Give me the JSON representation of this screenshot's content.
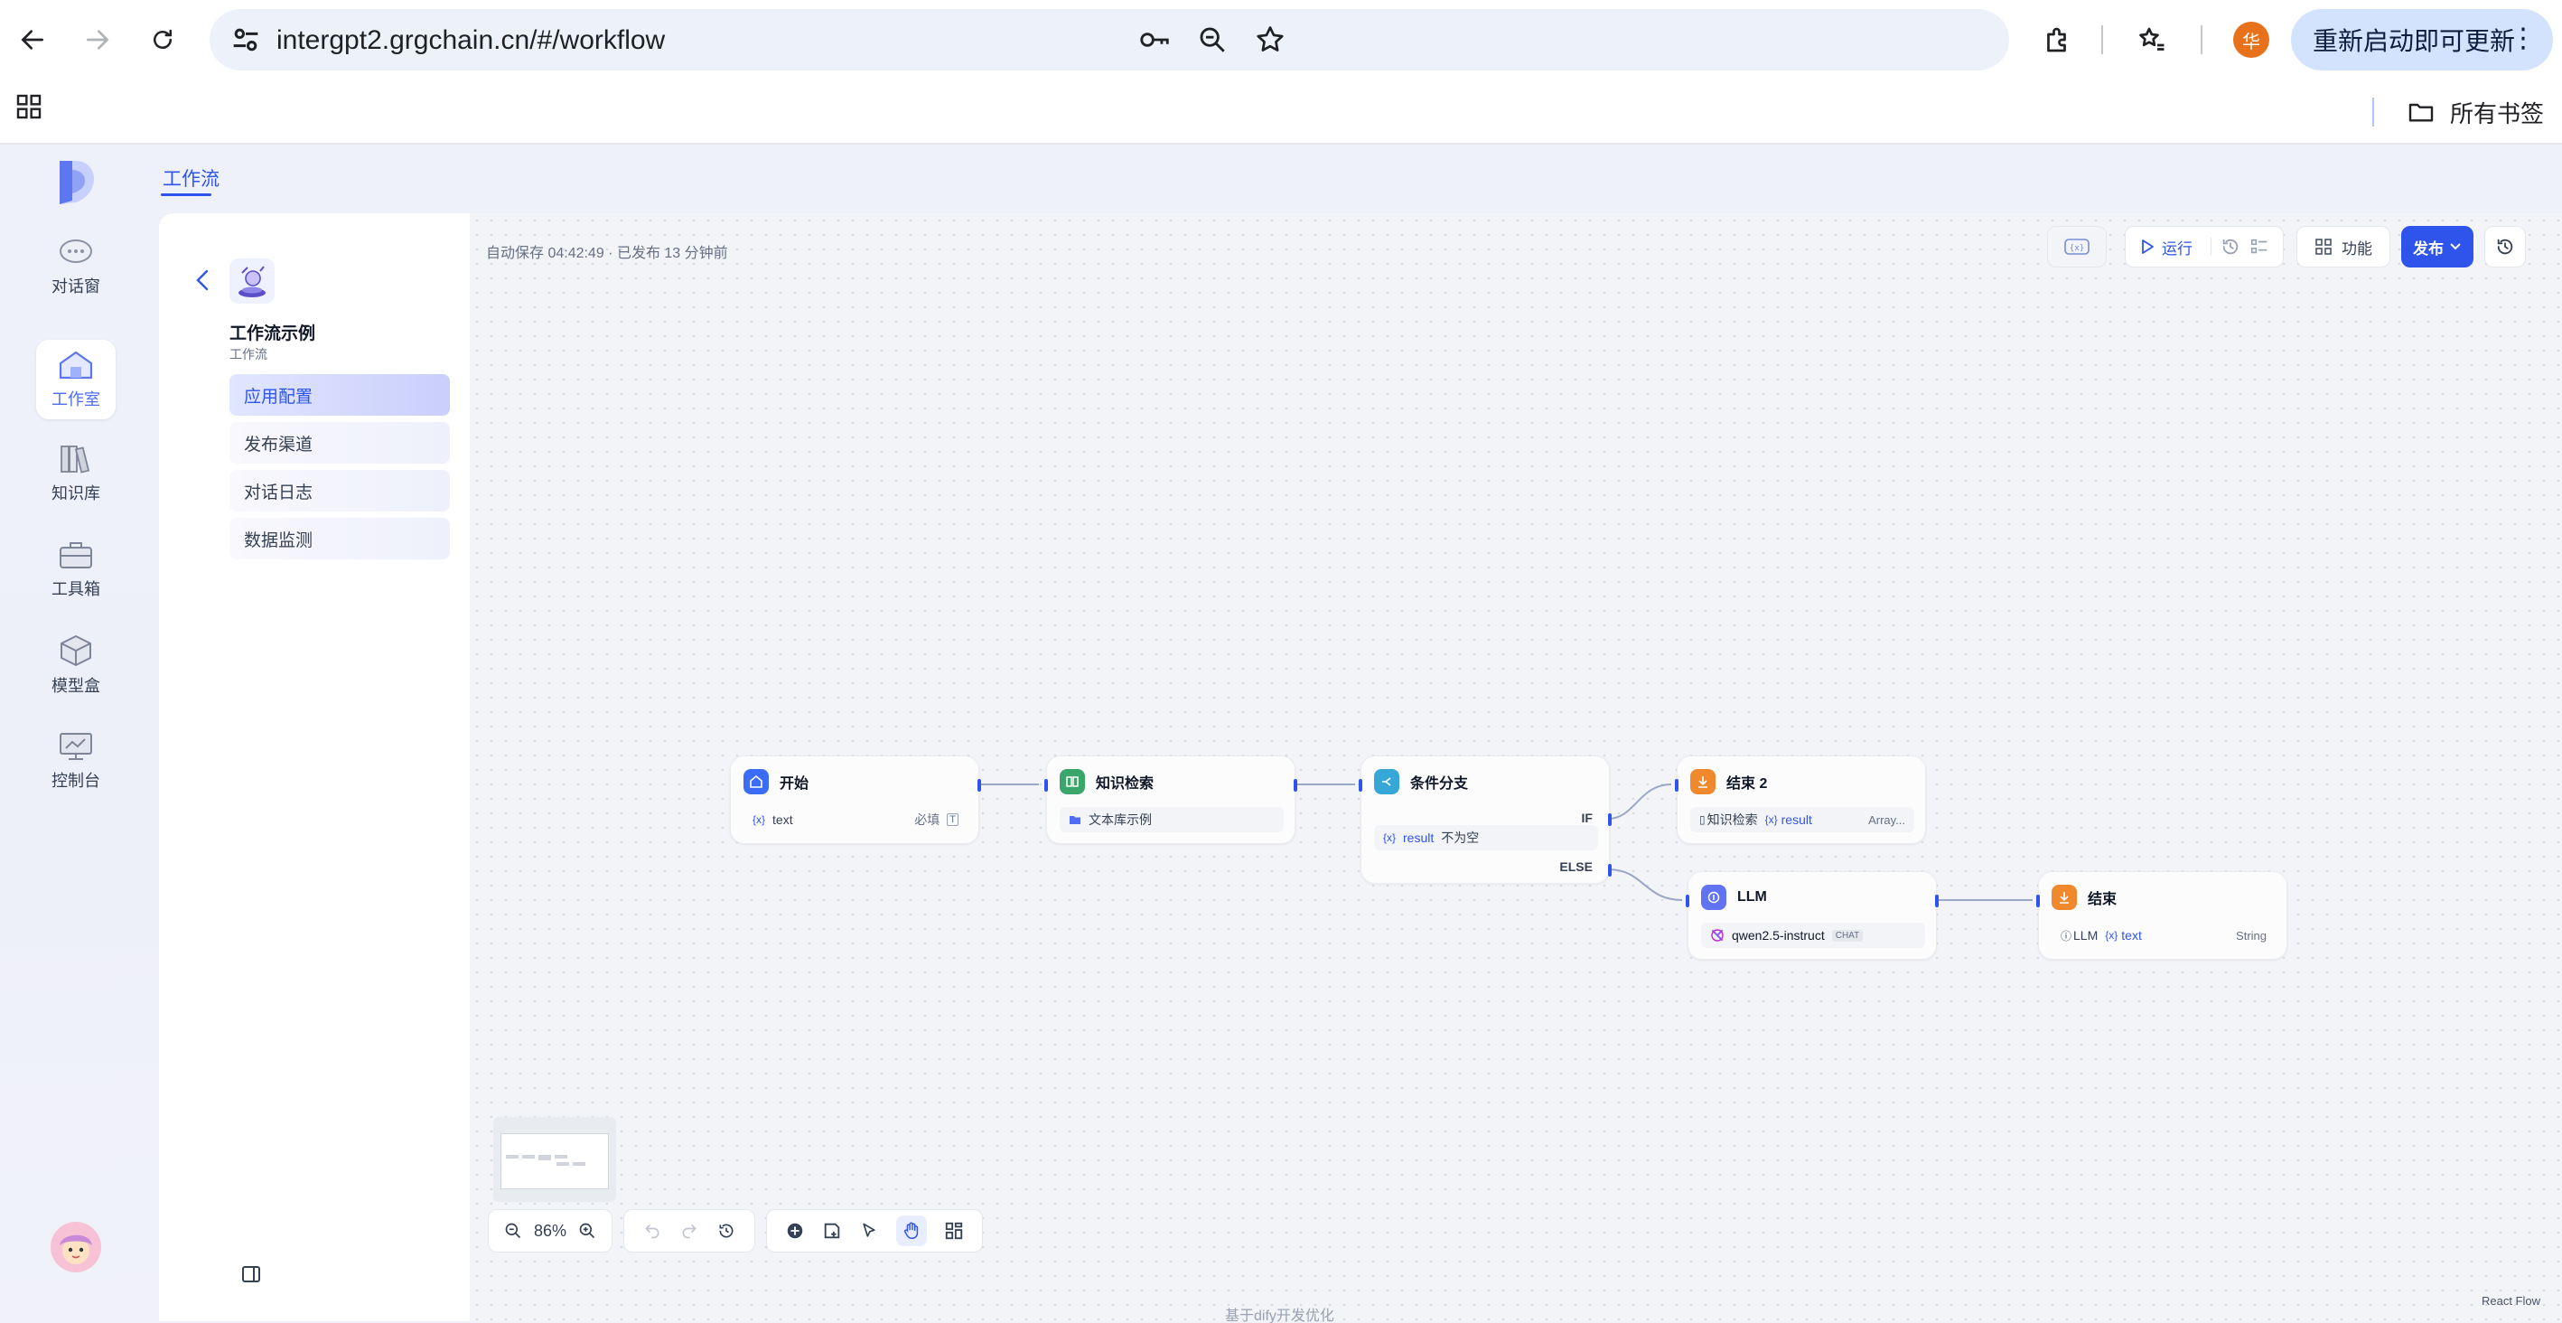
{
  "browser": {
    "url": "intergpt2.grgchain.cn/#/workflow",
    "update_button": "重新启动即可更新",
    "profile_initial": "华",
    "bookmarks_all": "所有书签"
  },
  "rail": {
    "items": [
      {
        "label": "对话窗",
        "icon": "chat-bubble-icon"
      },
      {
        "label": "工作室",
        "icon": "house-icon"
      },
      {
        "label": "知识库",
        "icon": "books-icon"
      },
      {
        "label": "工具箱",
        "icon": "toolbox-icon"
      },
      {
        "label": "模型盒",
        "icon": "box-icon"
      },
      {
        "label": "控制台",
        "icon": "monitor-icon"
      }
    ],
    "active": "工作室"
  },
  "top_tab": "工作流",
  "app": {
    "title": "工作流示例",
    "subtitle": "工作流",
    "menu": [
      "应用配置",
      "发布渠道",
      "对话日志",
      "数据监测"
    ],
    "active_menu": "应用配置"
  },
  "canvas": {
    "autosave": "自动保存 04:42:49 · 已发布 13 分钟前",
    "toolbar": {
      "run": "运行",
      "features": "功能",
      "publish": "发布",
      "env_var": "{x}"
    },
    "zoom": "86%"
  },
  "nodes": {
    "start": {
      "title": "开始",
      "var": "text",
      "required": "必填"
    },
    "knowledge": {
      "title": "知识检索",
      "dataset": "文本库示例"
    },
    "branch": {
      "title": "条件分支",
      "if_label": "IF",
      "else_label": "ELSE",
      "cond_var": "result",
      "cond_op": "不为空"
    },
    "end2": {
      "title": "结束 2",
      "source": "知识检索",
      "var": "result",
      "type": "Array..."
    },
    "llm": {
      "title": "LLM",
      "model": "qwen2.5-instruct",
      "mode": "CHAT"
    },
    "end": {
      "title": "结束",
      "source": "LLM",
      "var": "text",
      "type": "String"
    }
  },
  "footer": {
    "react_flow": "React Flow",
    "note": "基于dify开发优化"
  },
  "colors": {
    "accent": "#2f54eb",
    "start": "#3b6cf5",
    "knowledge": "#3aa66a",
    "branch": "#36a7d6",
    "end": "#f0882d",
    "llm": "#6172f3"
  }
}
